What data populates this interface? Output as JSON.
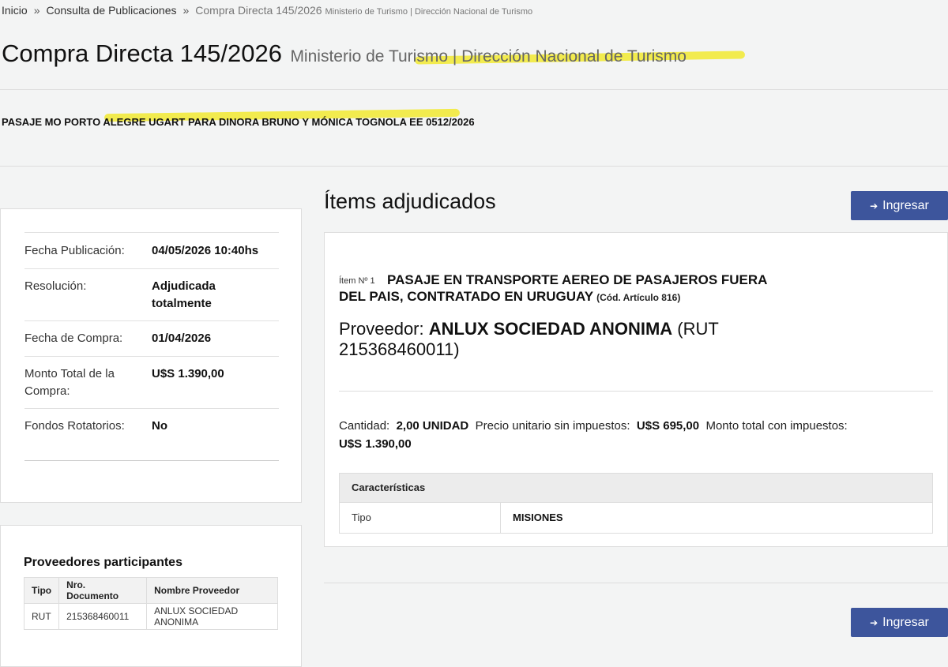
{
  "breadcrumb": {
    "home": "Inicio",
    "separator": "»",
    "section": "Consulta de Publicaciones",
    "current": "Compra Directa 145/2026",
    "current_sub": "Ministerio de Turismo | Dirección Nacional de Turismo"
  },
  "header": {
    "title": "Compra Directa 145/2026",
    "organization": "Ministerio de Turismo | Dirección Nacional de Turismo",
    "subject": "PASAJE MO PORTO ALEGRE UGART PARA DINORA BRUNO Y MÓNICA TOGNOLA EE 0512/2026"
  },
  "summary": {
    "fecha_publicacion_label": "Fecha Publicación:",
    "fecha_publicacion": "04/05/2026 10:40hs",
    "resolucion_label": "Resolución:",
    "resolucion": "Adjudicada totalmente",
    "fecha_compra_label": "Fecha de Compra:",
    "fecha_compra": "01/04/2026",
    "monto_label": "Monto Total de la Compra:",
    "monto": "U$S 1.390,00",
    "fondos_label": "Fondos Rotatorios:",
    "fondos": "No"
  },
  "proveedores": {
    "title": "Proveedores participantes",
    "headers": [
      "Tipo",
      "Nro. Documento",
      "Nombre Proveedor"
    ],
    "rows": [
      [
        "RUT",
        "215368460011",
        "ANLUX SOCIEDAD ANONIMA"
      ]
    ]
  },
  "items": {
    "heading": "Ítems adjudicados",
    "ingresar_label": "Ingresar",
    "item_no": "Ítem Nº 1",
    "desc_line1": "PASAJE EN TRANSPORTE AEREO DE PASAJEROS FUERA",
    "desc_line2": "DEL PAIS, CONTRATADO EN URUGUAY",
    "cod": "(Cód. Artículo 816)",
    "proveedor_label": "Proveedor:",
    "proveedor_name": "ANLUX SOCIEDAD ANONIMA",
    "proveedor_rut": "(RUT 215368460011)",
    "cantidad_label": "Cantidad:",
    "cantidad": "2,00 UNIDAD",
    "precio_label": "Precio unitario sin impuestos:",
    "precio": "U$S 695,00",
    "monto_label": "Monto total con impuestos:",
    "monto": "U$S 1.390,00",
    "caracteristicas_title": "Características",
    "tipo_label": "Tipo",
    "tipo_value": "MISIONES"
  },
  "icons": {
    "ingresar": "sign-in-icon"
  },
  "colors": {
    "button": "#3d559c",
    "highlight": "#f2ea3c"
  }
}
